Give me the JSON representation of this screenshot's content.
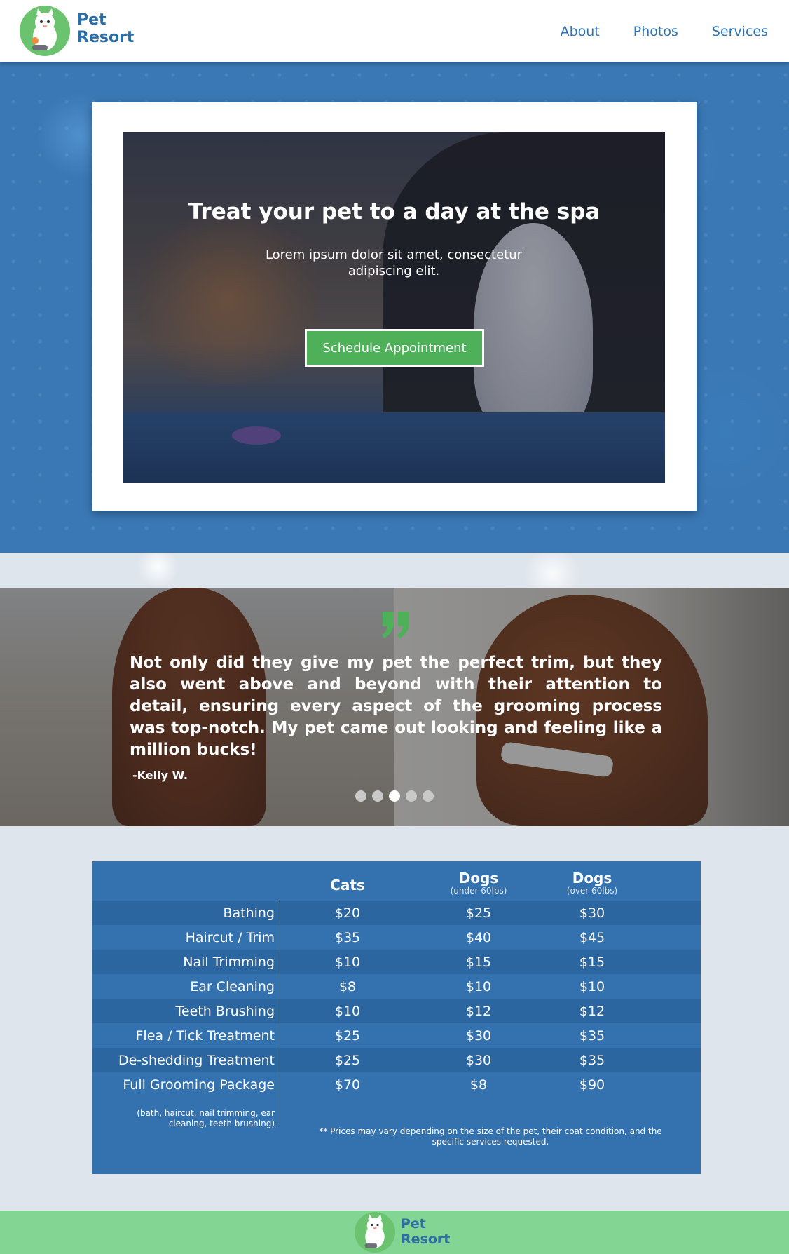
{
  "brand": {
    "name_line1": "Pet",
    "name_line2": "Resort"
  },
  "nav": {
    "links": [
      "About",
      "Photos",
      "Services"
    ]
  },
  "hero": {
    "title": "Treat your pet to a day at the spa",
    "subtitle": "Lorem ipsum dolor sit amet, consectetur adipiscing elit.",
    "cta_label": "Schedule Appointment"
  },
  "testimonial": {
    "quote": "Not only did they give my pet the perfect trim, but  they also went above and beyond with their attention to detail, ensuring  every aspect of the grooming process was top-notch. My pet came out looking and feeling like a million bucks!",
    "author": "-Kelly W.",
    "slide_count": 5,
    "active_slide": 3
  },
  "pricing": {
    "columns": [
      {
        "title": "Cats",
        "subtitle": ""
      },
      {
        "title": "Dogs",
        "subtitle": "(under 60lbs)"
      },
      {
        "title": "Dogs",
        "subtitle": "(over 60lbs)"
      }
    ],
    "rows": [
      {
        "service": "Bathing",
        "prices": [
          "$20",
          "$25",
          "$30"
        ]
      },
      {
        "service": "Haircut / Trim",
        "prices": [
          "$35",
          "$40",
          "$45"
        ]
      },
      {
        "service": "Nail Trimming",
        "prices": [
          "$10",
          "$15",
          "$15"
        ]
      },
      {
        "service": "Ear Cleaning",
        "prices": [
          "$8",
          "$10",
          "$10"
        ]
      },
      {
        "service": "Teeth Brushing",
        "prices": [
          "$10",
          "$12",
          "$12"
        ]
      },
      {
        "service": "Flea / Tick Treatment",
        "prices": [
          "$25",
          "$30",
          "$35"
        ]
      },
      {
        "service": "De-shedding Treatment",
        "prices": [
          "$25",
          "$30",
          "$35"
        ]
      },
      {
        "service": "Full Grooming Package",
        "prices": [
          "$70",
          "$8",
          "$90"
        ]
      }
    ],
    "package_note": "(bath, haircut, nail trimming, ear cleaning, teeth brushing)",
    "footnote": "** Prices may vary depending on the size of the pet, their coat condition, and the specific services requested."
  },
  "colors": {
    "brand_blue": "#2e6ea6",
    "accent_green": "#4fb05a",
    "panel_blue": "#3472af",
    "footer_green": "#83d593"
  }
}
